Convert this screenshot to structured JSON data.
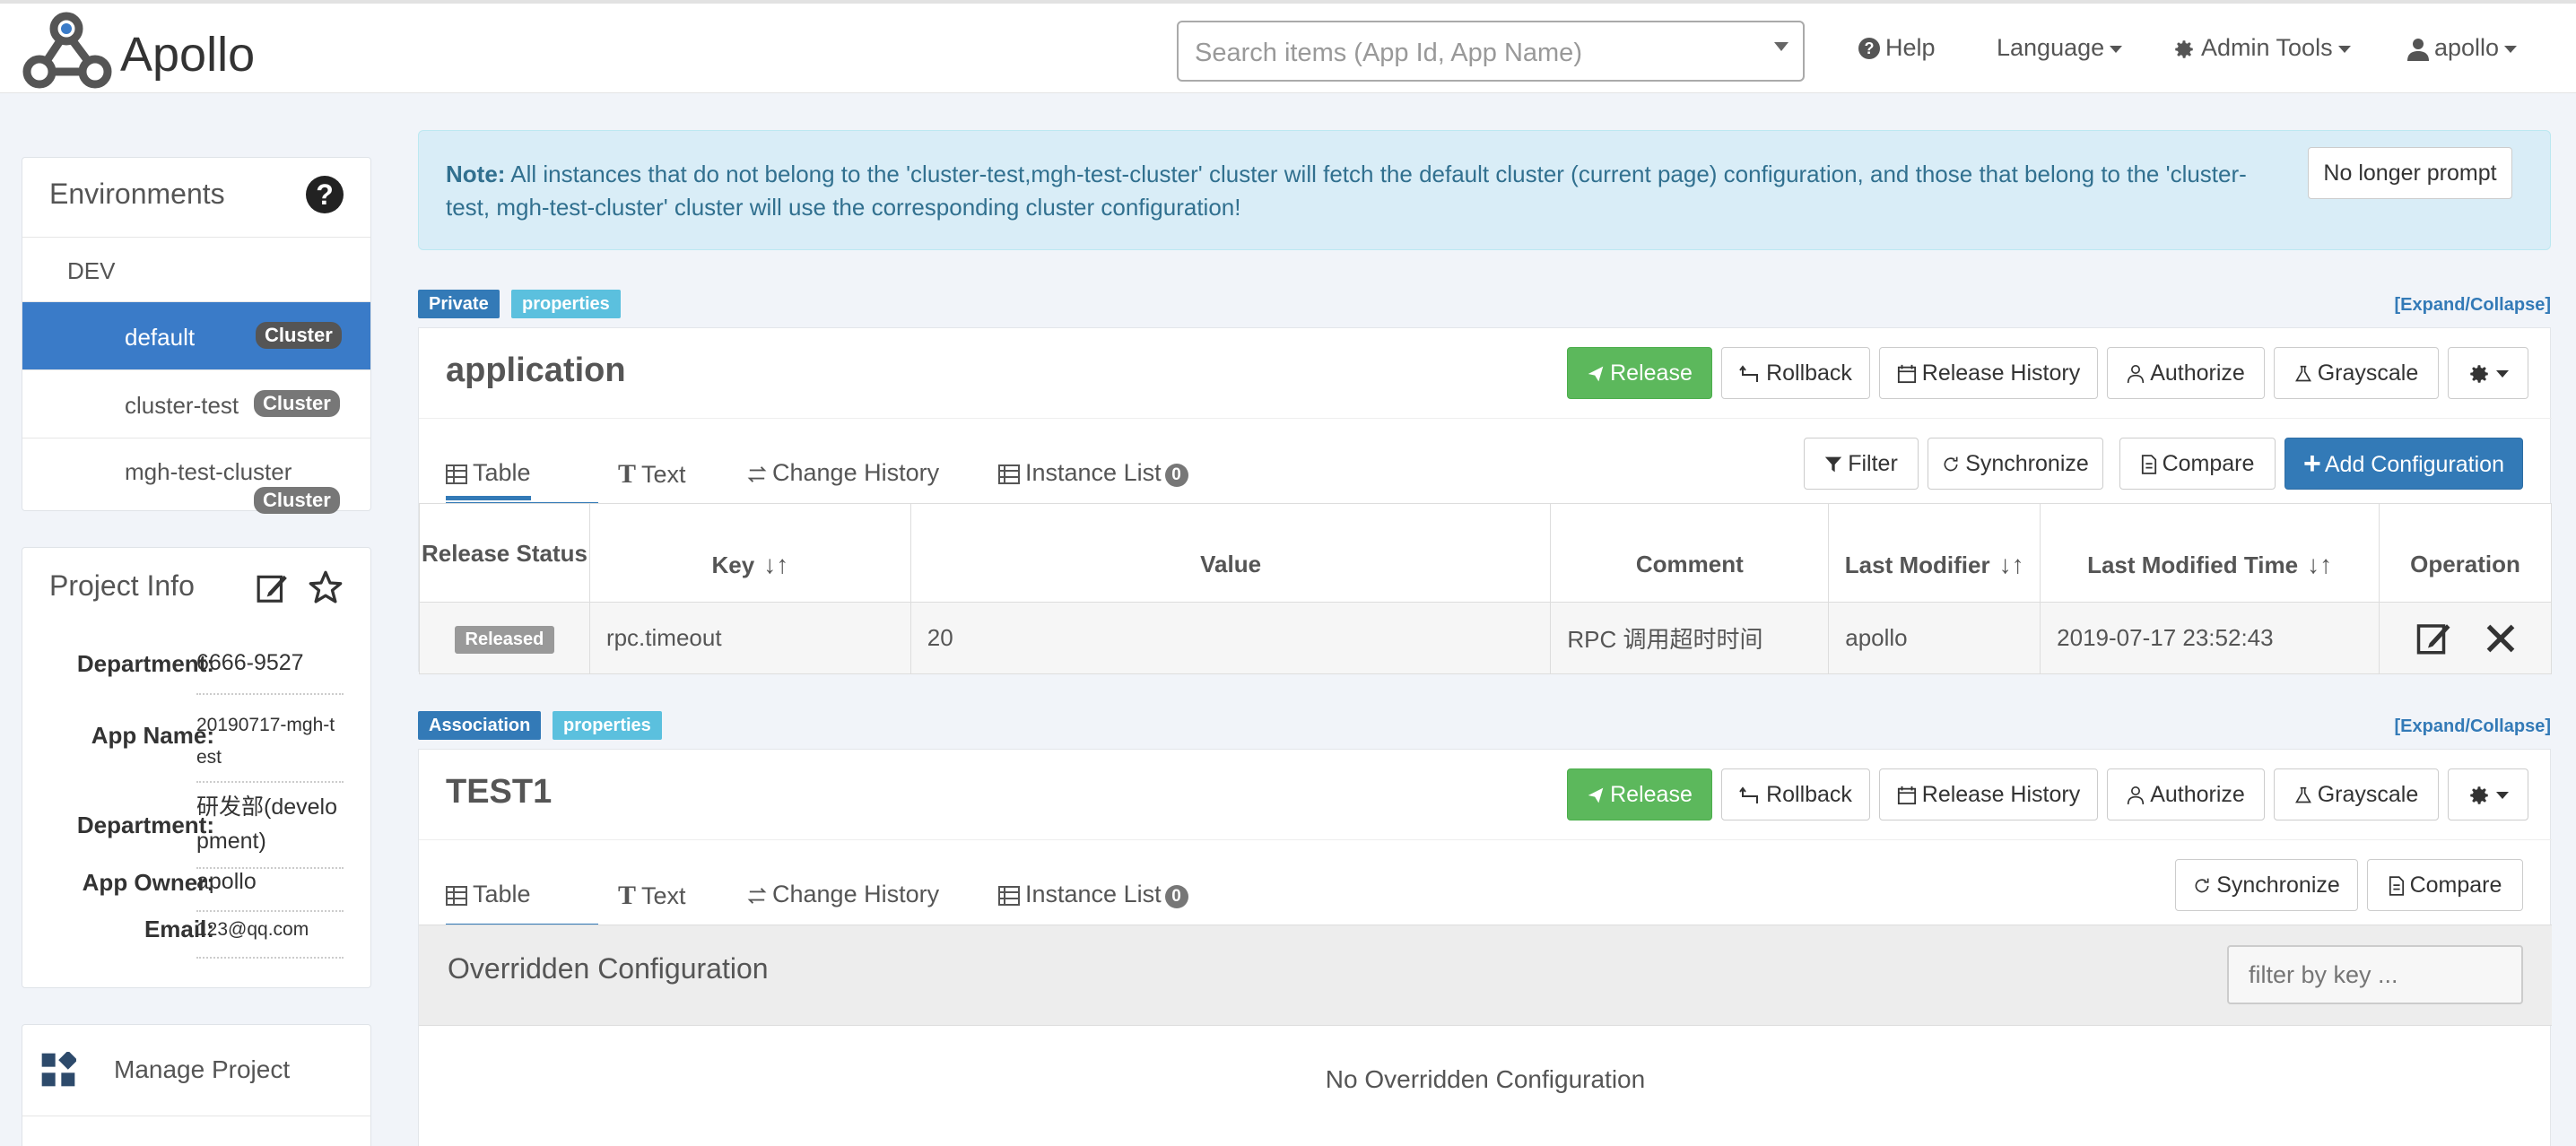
{
  "nav": {
    "brand": "Apollo",
    "search_placeholder": "Search items (App Id, App Name)",
    "help": "Help",
    "language": "Language",
    "admin_tools": "Admin Tools",
    "user": "apollo"
  },
  "environments": {
    "title": "Environments",
    "env_name": "DEV",
    "clusters": [
      {
        "name": "default",
        "badge": "Cluster",
        "active": true
      },
      {
        "name": "cluster-test",
        "badge": "Cluster"
      },
      {
        "name": "mgh-test-cluster",
        "badge": "Cluster"
      }
    ]
  },
  "project_info": {
    "title": "Project Info",
    "rows": [
      {
        "key": "Department:",
        "value": "6666-9527"
      },
      {
        "key": "App Name:",
        "value": "20190717-mgh-test"
      },
      {
        "key": "Department:",
        "value": "研发部(development)"
      },
      {
        "key": "App Owner:",
        "value": "apollo"
      },
      {
        "key": "Email:",
        "value": "123@qq.com"
      }
    ]
  },
  "manage_project": "Manage Project",
  "note": {
    "prefix": "Note:",
    "text": " All instances that do not belong to the 'cluster-test,mgh-test-cluster' cluster will fetch the default cluster (current page) configuration, and those that belong to the 'cluster-test, mgh-test-cluster' cluster will use the corresponding cluster configuration!",
    "dismiss": "No longer prompt"
  },
  "namespaces": [
    {
      "tag_type": "Private",
      "tag_format": "properties",
      "expand": "[Expand/Collapse]",
      "name": "application",
      "actions": [
        "Release",
        "Rollback",
        "Release History",
        "Authorize",
        "Grayscale"
      ],
      "tabs": [
        "Table",
        "Text",
        "Change History",
        "Instance List"
      ],
      "instance_count": "0",
      "toolbar": [
        "Filter",
        "Synchronize",
        "Compare",
        "Add Configuration"
      ],
      "columns": [
        "Release Status",
        "Key",
        "Value",
        "Comment",
        "Last Modifier",
        "Last Modified Time",
        "Operation"
      ],
      "rows": [
        {
          "status": "Released",
          "key": "rpc.timeout",
          "value": "20",
          "comment": "RPC 调用超时时间",
          "modifier": "apollo",
          "time": "2019-07-17 23:52:43"
        }
      ]
    },
    {
      "tag_type": "Association",
      "tag_format": "properties",
      "expand": "[Expand/Collapse]",
      "name": "TEST1",
      "actions": [
        "Release",
        "Rollback",
        "Release History",
        "Authorize",
        "Grayscale"
      ],
      "tabs": [
        "Table",
        "Text",
        "Change History",
        "Instance List"
      ],
      "instance_count": "0",
      "toolbar": [
        "Synchronize",
        "Compare"
      ],
      "override_title": "Overridden Configuration",
      "filter_placeholder": "filter by key ...",
      "no_override": "No Overridden Configuration"
    }
  ],
  "colors": {
    "primary": "#337ab7",
    "success": "#5cb85c",
    "info_bg": "#d9edf7",
    "active_cluster": "#3a7bc8"
  }
}
